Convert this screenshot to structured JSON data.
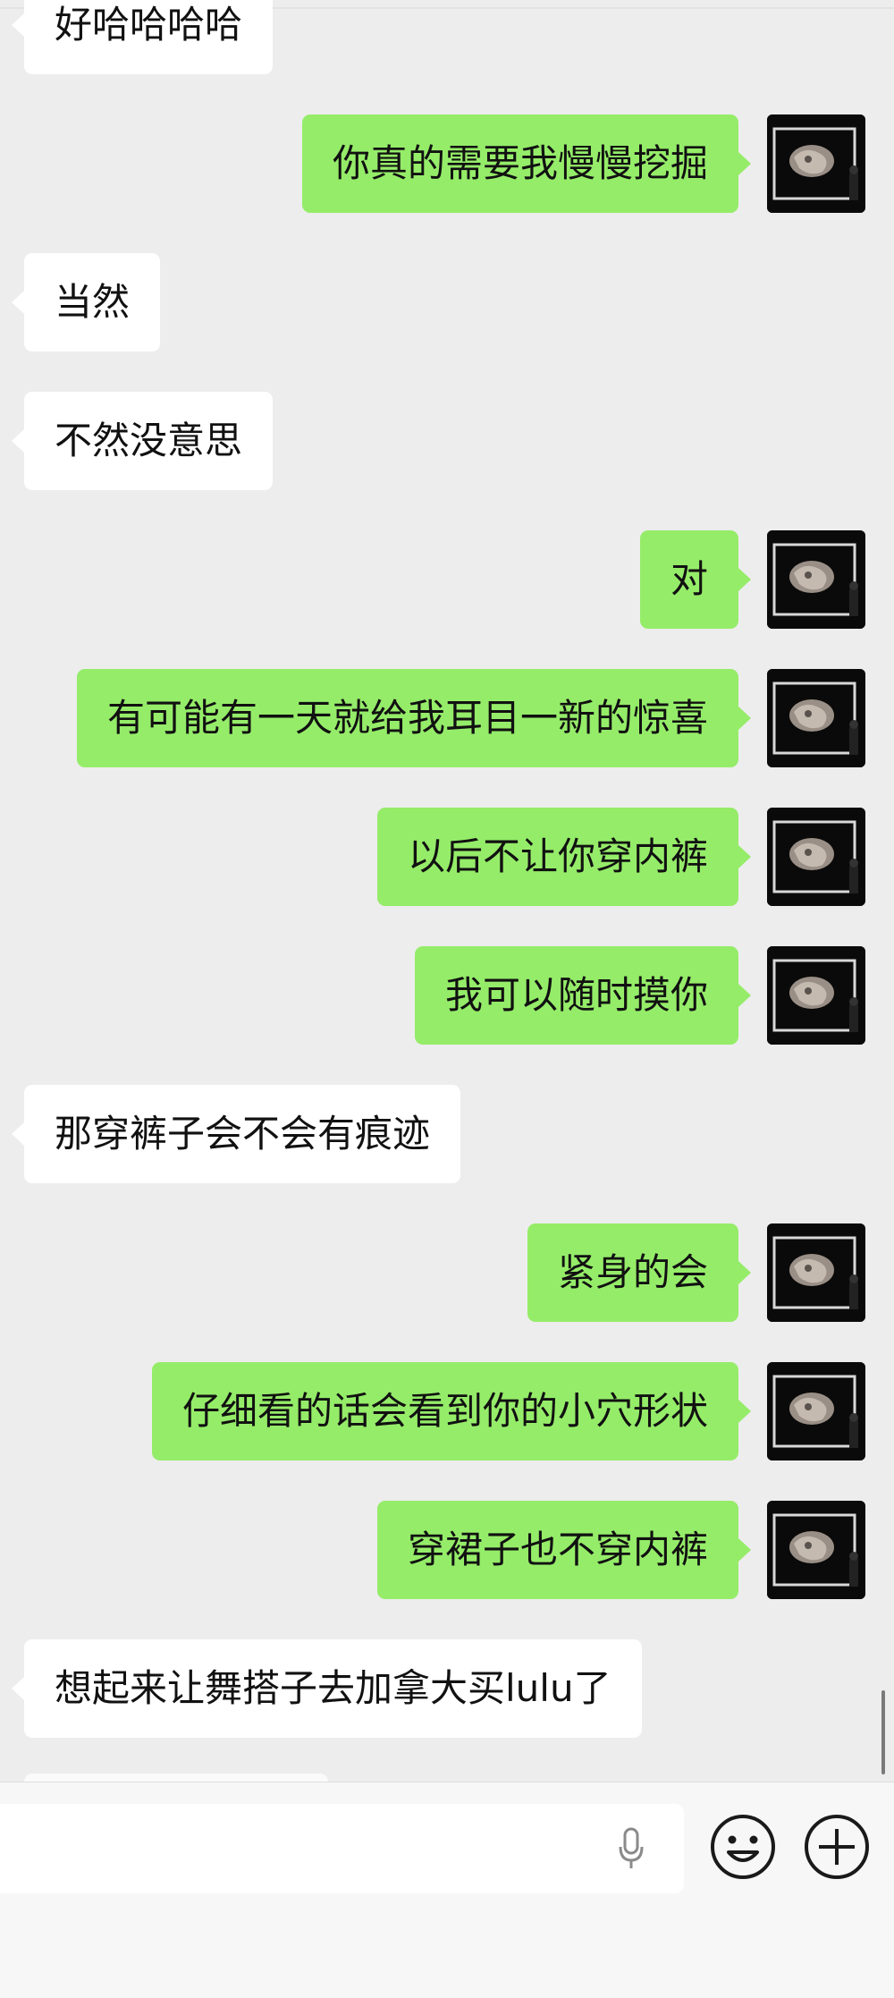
{
  "messages": [
    {
      "side": "left",
      "text": "好哈哈哈哈"
    },
    {
      "side": "right",
      "text": "你真的需要我慢慢挖掘"
    },
    {
      "side": "left",
      "text": "当然"
    },
    {
      "side": "left",
      "text": "不然没意思"
    },
    {
      "side": "right",
      "text": "对"
    },
    {
      "side": "right",
      "text": "有可能有一天就给我耳目一新的惊喜"
    },
    {
      "side": "right",
      "text": "以后不让你穿内裤"
    },
    {
      "side": "right",
      "text": "我可以随时摸你"
    },
    {
      "side": "left",
      "text": "那穿裤子会不会有痕迹"
    },
    {
      "side": "right",
      "text": "紧身的会"
    },
    {
      "side": "right",
      "text": "仔细看的话会看到你的小穴形状"
    },
    {
      "side": "right",
      "text": "穿裙子也不穿内裤"
    },
    {
      "side": "left",
      "text": "想起来让舞搭子去加拿大买lulu了"
    }
  ],
  "input_bar": {
    "input_value": "",
    "voice_icon": "microphone-icon",
    "emoji_icon": "smiley-face-icon",
    "more_icon": "plus-circle-icon"
  },
  "colors": {
    "background": "#ededed",
    "incoming_bubble": "#ffffff",
    "outgoing_bubble": "#95ec69",
    "text": "#111111",
    "input_bar": "#f7f7f7"
  }
}
